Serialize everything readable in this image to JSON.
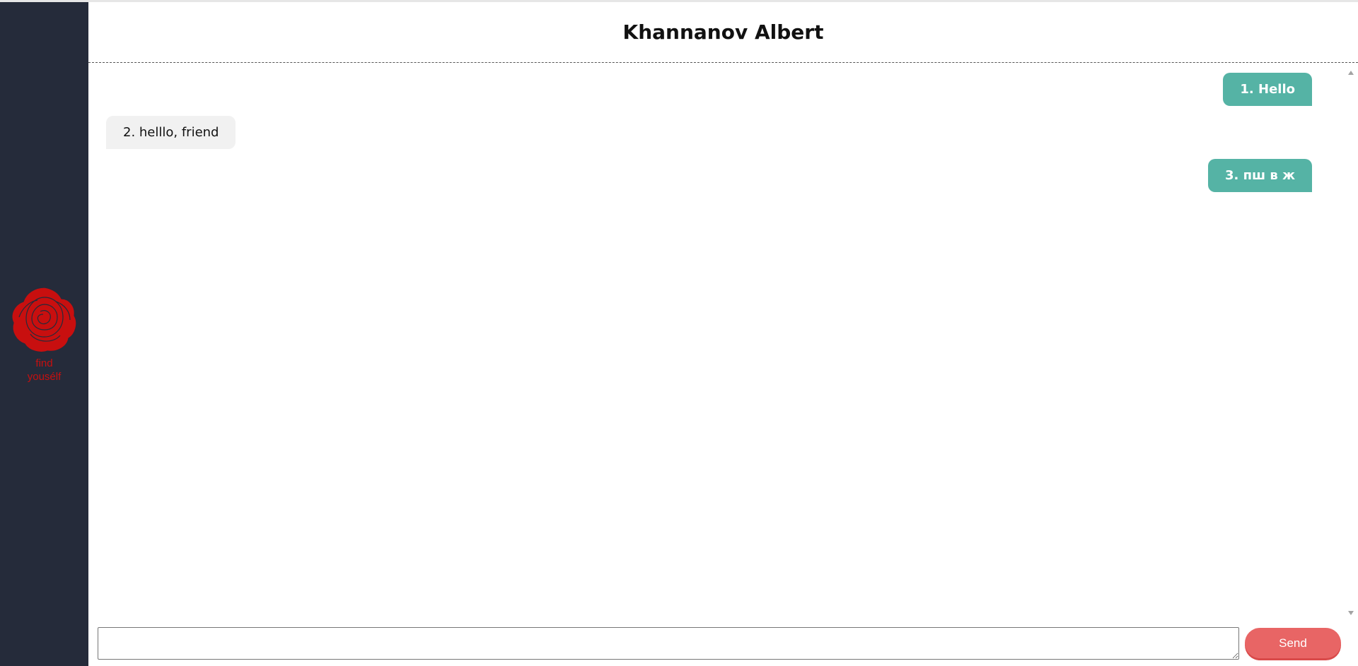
{
  "sidebar": {
    "logo_icon": "rose-icon",
    "logo_text": "find yousélf",
    "logo_color": "#c80f0f",
    "background": "#252b3a"
  },
  "header": {
    "title": "Khannanov Albert"
  },
  "messages": [
    {
      "direction": "outgoing",
      "text": "1. Hello"
    },
    {
      "direction": "incoming",
      "text": "2. helllo, friend"
    },
    {
      "direction": "outgoing",
      "text": "3. пш в ж"
    }
  ],
  "composer": {
    "input_value": "",
    "send_label": "Send"
  },
  "colors": {
    "outgoing_bubble": "#55b3a5",
    "incoming_bubble": "#f1f1f1",
    "send_button": "#e86565"
  }
}
